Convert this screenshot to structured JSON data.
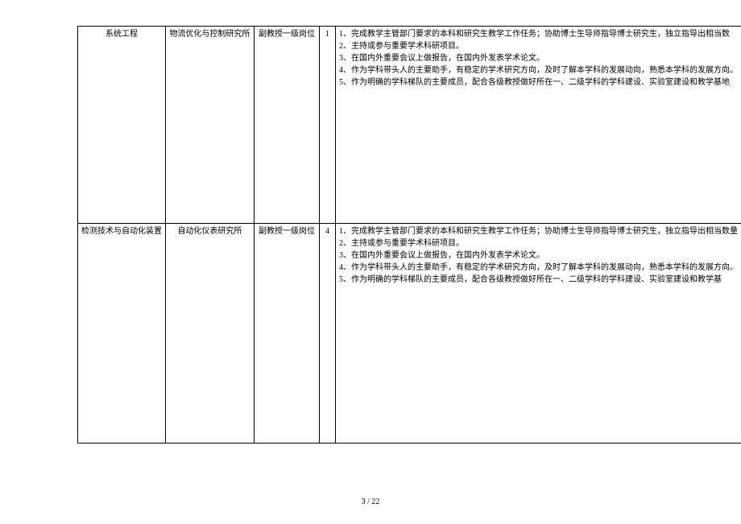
{
  "rows": [
    {
      "c1": "系统工程",
      "c2": "物流优化与控制研究所",
      "c3": "副教授一级岗位",
      "c4": "1",
      "lines": [
        "1、完成教学主管部门要求的本科和研究生教学工作任务；协助博士生导师指导博士研究生，独立指导出相当数",
        "2、主持或参与重要学术科研项目。",
        "3、在国内外重要会议上做报告，在国内外发表学术论文。",
        "4、作为学科带头人的主要助手，有稳定的学术研究方向，及时了解本学科的发展动向，熟悉本学科的发展方向。",
        "5、作为明确的学科梯队的主要成员，配合各级教授做好所在一、二级学科的学科建设、实验室建设和教学基地"
      ]
    },
    {
      "c1": "检测技术与自动化装置",
      "c2": "自动化仪表研究所",
      "c3": "副教授一级岗位",
      "c4": "4",
      "lines": [
        "1、完成教学主管部门要求的本科和研究生教学工作任务；协助博士生导师指导博士研究生，独立指导出相当数量",
        "2、主持或参与重要学术科研项目。",
        "3、在国内外重要会议上做报告，在国内外发表学术论文。",
        "4、作为学科带头人的主要助手，有稳定的学术研究方向，及时了解本学科的发展动向，熟悉本学科的发展方向。",
        "5、作为明确的学科梯队的主要成员，配合各级教授做好所在一、二级学科的学科建设、实验室建设和教学基"
      ]
    }
  ],
  "footer": "3 / 22"
}
